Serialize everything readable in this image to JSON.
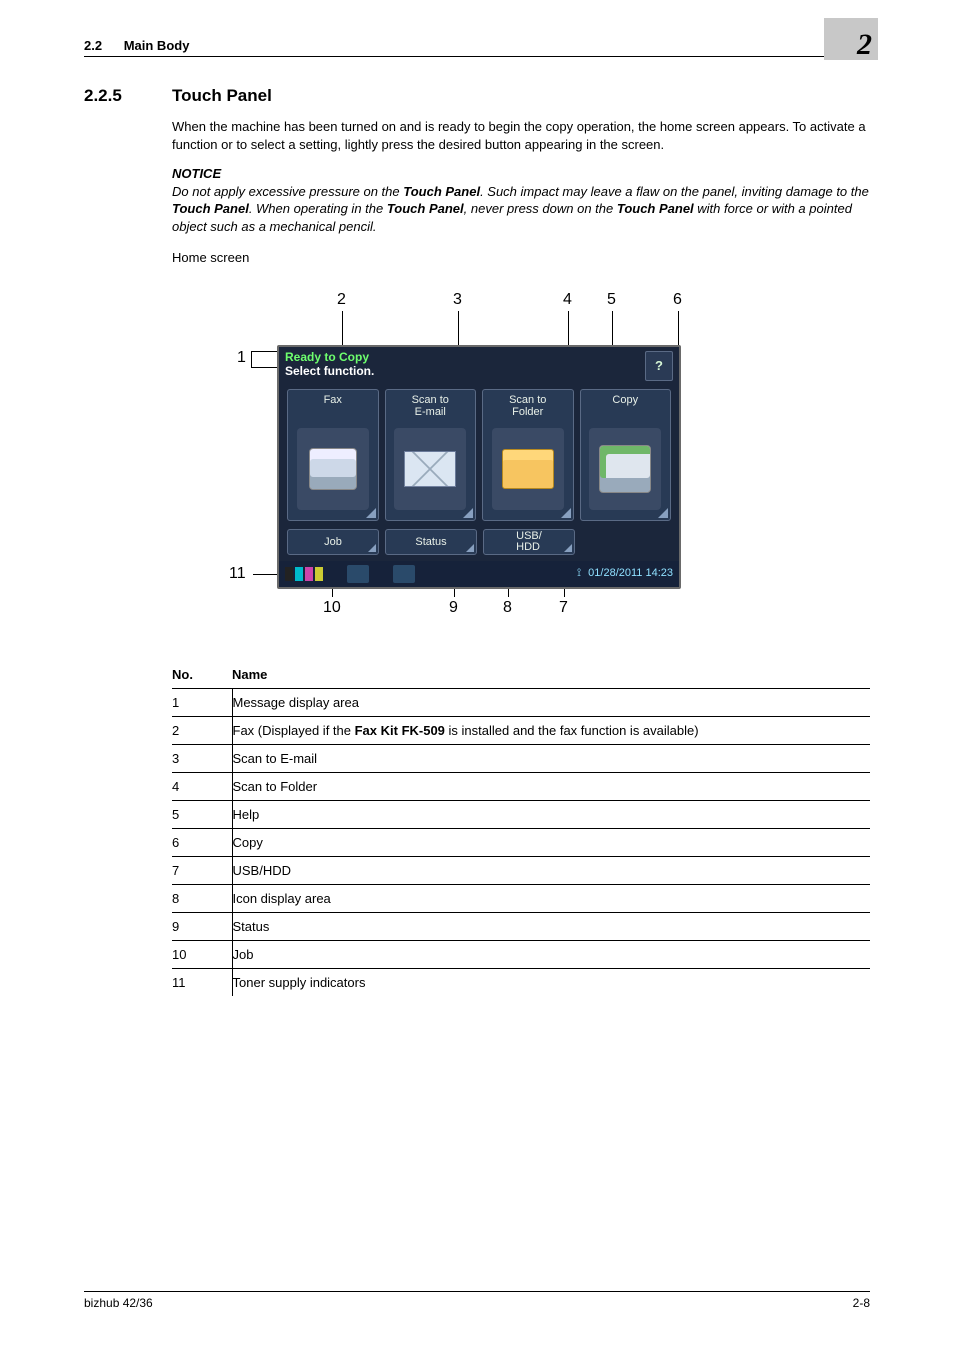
{
  "header": {
    "section_number": "2.2",
    "section_name": "Main Body",
    "chapter_number": "2"
  },
  "section": {
    "number": "2.2.5",
    "title": "Touch Panel"
  },
  "intro": {
    "p1": "When the machine has been turned on and is ready to begin the copy operation, the home screen appears. To activate a function or to select a setting, lightly press the desired button appearing in the screen.",
    "notice_label": "NOTICE",
    "notice_pre": "Do not apply excessive pressure on the ",
    "notice_mid1": ". Such impact may leave a flaw on the panel, inviting damage to the ",
    "notice_mid2": ". When operating in the ",
    "notice_mid3": ", never press down on the ",
    "notice_end": " with force or with a pointed object such as a mechanical pencil.",
    "touch_panel": "Touch Panel",
    "home_screen_label": "Home screen"
  },
  "shot": {
    "msg_line1": "Ready to Copy",
    "msg_line2": "Select function.",
    "help": "?",
    "tiles": {
      "fax": "Fax",
      "scan_email": "Scan to\nE-mail",
      "scan_folder": "Scan to\nFolder",
      "copy": "Copy"
    },
    "buttons": {
      "job": "Job",
      "status": "Status",
      "usbhdd": "USB/\nHDD"
    },
    "datetime": "01/28/2011  14:23"
  },
  "callouts": {
    "c1": "1",
    "c2": "2",
    "c3": "3",
    "c4": "4",
    "c5": "5",
    "c6": "6",
    "c7": "7",
    "c8": "8",
    "c9": "9",
    "c10": "10",
    "c11": "11"
  },
  "table": {
    "head_no": "No.",
    "head_name": "Name",
    "rows": [
      {
        "no": "1",
        "name_pre": "Message display area",
        "fk": "",
        "name_post": ""
      },
      {
        "no": "2",
        "name_pre": "Fax (Displayed if the ",
        "fk": "Fax Kit FK-509",
        "name_post": " is installed and the fax function is available)"
      },
      {
        "no": "3",
        "name_pre": "Scan to E-mail",
        "fk": "",
        "name_post": ""
      },
      {
        "no": "4",
        "name_pre": "Scan to Folder",
        "fk": "",
        "name_post": ""
      },
      {
        "no": "5",
        "name_pre": "Help",
        "fk": "",
        "name_post": ""
      },
      {
        "no": "6",
        "name_pre": "Copy",
        "fk": "",
        "name_post": ""
      },
      {
        "no": "7",
        "name_pre": "USB/HDD",
        "fk": "",
        "name_post": ""
      },
      {
        "no": "8",
        "name_pre": "Icon display area",
        "fk": "",
        "name_post": ""
      },
      {
        "no": "9",
        "name_pre": "Status",
        "fk": "",
        "name_post": ""
      },
      {
        "no": "10",
        "name_pre": "Job",
        "fk": "",
        "name_post": ""
      },
      {
        "no": "11",
        "name_pre": "Toner supply indicators",
        "fk": "",
        "name_post": ""
      }
    ]
  },
  "footer": {
    "left": "bizhub 42/36",
    "right": "2-8"
  }
}
